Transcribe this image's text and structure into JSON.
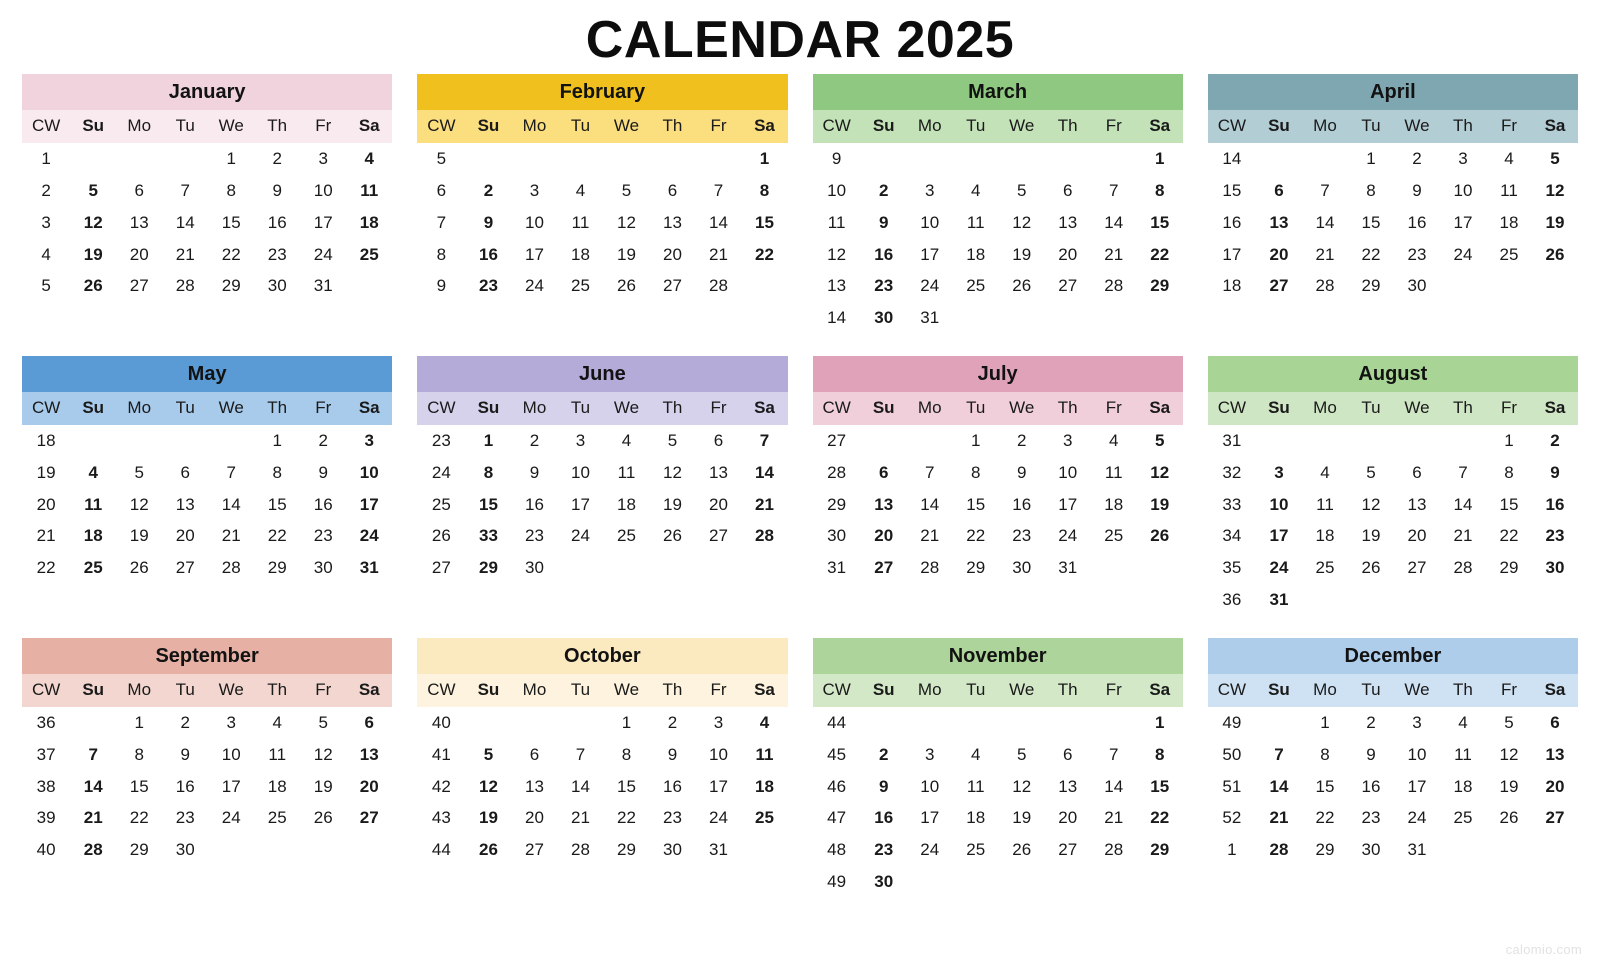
{
  "title": "CALENDAR 2025",
  "watermark": "calomio.com",
  "weekday_headers": [
    "CW",
    "Su",
    "Mo",
    "Tu",
    "We",
    "Th",
    "Fr",
    "Sa"
  ],
  "weekend_columns": [
    1,
    7
  ],
  "colors": {
    "january_header": "#f0d3dc",
    "january_sub": "#f9eaef",
    "february_header": "#f0c01f",
    "february_sub": "#fbde7e",
    "march_header": "#8fc881",
    "march_sub": "#c3e2b8",
    "april_header": "#7fa7b2",
    "april_sub": "#b3cdd4",
    "may_header": "#5b9bd5",
    "may_sub": "#a8cbeb",
    "june_header": "#b4abd8",
    "june_sub": "#d7d2ec",
    "july_header": "#dfa2b8",
    "july_sub": "#f0cfdb",
    "august_header": "#a8d495",
    "august_sub": "#cfe6c4",
    "september_header": "#e6b0a5",
    "september_sub": "#f2d6cf",
    "october_header": "#fbe9bf",
    "october_sub": "#fdf3de",
    "november_header": "#add49a",
    "november_sub": "#d2e8c7",
    "december_header": "#aecdeb",
    "december_sub": "#cfe2f4",
    "title_text": "#0d0d0d",
    "cw_text": "#b3b3b3",
    "day_text": "#111111",
    "watermark_text": "#e2e2e2"
  },
  "months": [
    {
      "name": "January",
      "header_color": "#f0d3dc",
      "sub_color": "#f9eaef",
      "weeks": [
        {
          "cw": "1",
          "days": [
            "",
            "",
            "1",
            "2",
            "3",
            "4"
          ]
        },
        {
          "cw": "2",
          "days": [
            "5",
            "6",
            "7",
            "8",
            "9",
            "10",
            "11"
          ]
        },
        {
          "cw": "3",
          "days": [
            "12",
            "13",
            "14",
            "15",
            "16",
            "17",
            "18"
          ]
        },
        {
          "cw": "4",
          "days": [
            "19",
            "20",
            "21",
            "22",
            "23",
            "24",
            "25"
          ]
        },
        {
          "cw": "5",
          "days": [
            "26",
            "27",
            "28",
            "29",
            "30",
            "31",
            ""
          ]
        }
      ],
      "rows": [
        [
          "1",
          "",
          "",
          "1",
          "2",
          "3",
          "4"
        ],
        [
          "2",
          "5",
          "6",
          "7",
          "8",
          "9",
          "10",
          "11"
        ]
      ]
    },
    {
      "name": "February",
      "header_color": "#f0c01f",
      "sub_color": "#fbde7e",
      "weeks": []
    },
    {
      "name": "March",
      "header_color": "#8fc881",
      "sub_color": "#c3e2b8",
      "weeks": []
    },
    {
      "name": "April",
      "header_color": "#7fa7b2",
      "sub_color": "#b3cdd4",
      "weeks": []
    },
    {
      "name": "May",
      "header_color": "#5b9bd5",
      "sub_color": "#a8cbeb",
      "weeks": []
    },
    {
      "name": "June",
      "header_color": "#b4abd8",
      "sub_color": "#d7d2ec",
      "weeks": []
    },
    {
      "name": "July",
      "header_color": "#dfa2b8",
      "sub_color": "#f0cfdb",
      "weeks": []
    },
    {
      "name": "August",
      "header_color": "#a8d495",
      "sub_color": "#cfe6c4",
      "weeks": []
    },
    {
      "name": "September",
      "header_color": "#e6b0a5",
      "sub_color": "#f2d6cf",
      "weeks": []
    },
    {
      "name": "October",
      "header_color": "#fbe9bf",
      "sub_color": "#fdf3de",
      "weeks": []
    },
    {
      "name": "November",
      "header_color": "#add49a",
      "sub_color": "#d2e8c7",
      "weeks": []
    },
    {
      "name": "December",
      "header_color": "#aecdeb",
      "sub_color": "#cfe2f4",
      "weeks": []
    }
  ],
  "calendar_grid": [
    {
      "name": "January",
      "header_color": "#f0d3dc",
      "sub_color": "#f9eaef",
      "rows": [
        [
          "1",
          "",
          "",
          "",
          "1",
          "2",
          "3",
          "4"
        ],
        [
          "2",
          "5",
          "6",
          "7",
          "8",
          "9",
          "10",
          "11"
        ],
        [
          "3",
          "12",
          "13",
          "14",
          "15",
          "16",
          "17",
          "18"
        ],
        [
          "4",
          "19",
          "20",
          "21",
          "22",
          "23",
          "24",
          "25"
        ],
        [
          "5",
          "26",
          "27",
          "28",
          "29",
          "30",
          "31",
          ""
        ]
      ]
    },
    {
      "name": "February",
      "header_color": "#f0c01f",
      "sub_color": "#fbde7e",
      "rows": [
        [
          "5",
          "",
          "",
          "",
          "",
          "",
          "",
          "1"
        ],
        [
          "6",
          "2",
          "3",
          "4",
          "5",
          "6",
          "7",
          "8"
        ],
        [
          "7",
          "9",
          "10",
          "11",
          "12",
          "13",
          "14",
          "15"
        ],
        [
          "8",
          "16",
          "17",
          "18",
          "19",
          "20",
          "21",
          "22"
        ],
        [
          "9",
          "23",
          "24",
          "25",
          "26",
          "27",
          "28",
          ""
        ]
      ]
    },
    {
      "name": "March",
      "header_color": "#8fc881",
      "sub_color": "#c3e2b8",
      "rows": [
        [
          "9",
          "",
          "",
          "",
          "",
          "",
          "",
          "1"
        ],
        [
          "10",
          "2",
          "3",
          "4",
          "5",
          "6",
          "7",
          "8"
        ],
        [
          "11",
          "9",
          "10",
          "11",
          "12",
          "13",
          "14",
          "15"
        ],
        [
          "12",
          "16",
          "17",
          "18",
          "19",
          "20",
          "21",
          "22"
        ],
        [
          "13",
          "23",
          "24",
          "25",
          "26",
          "27",
          "28",
          "29"
        ],
        [
          "14",
          "30",
          "31",
          "",
          "",
          "",
          "",
          ""
        ]
      ]
    },
    {
      "name": "April",
      "header_color": "#7fa7b2",
      "sub_color": "#b3cdd4",
      "rows": [
        [
          "14",
          "",
          "",
          "1",
          "2",
          "3",
          "4",
          "5"
        ],
        [
          "15",
          "6",
          "7",
          "8",
          "9",
          "10",
          "11",
          "12"
        ],
        [
          "16",
          "13",
          "14",
          "15",
          "16",
          "17",
          "18",
          "19"
        ],
        [
          "17",
          "20",
          "21",
          "22",
          "23",
          "24",
          "25",
          "26"
        ],
        [
          "18",
          "27",
          "28",
          "29",
          "30",
          "",
          "",
          ""
        ]
      ]
    },
    {
      "name": "May",
      "header_color": "#5b9bd5",
      "sub_color": "#a8cbeb",
      "rows": [
        [
          "18",
          "",
          "",
          "",
          "",
          "1",
          "2",
          "3"
        ],
        [
          "19",
          "4",
          "5",
          "6",
          "7",
          "8",
          "9",
          "10"
        ],
        [
          "20",
          "11",
          "12",
          "13",
          "14",
          "15",
          "16",
          "17"
        ],
        [
          "21",
          "18",
          "19",
          "20",
          "21",
          "22",
          "23",
          "24"
        ],
        [
          "22",
          "25",
          "26",
          "27",
          "28",
          "29",
          "30",
          "31"
        ]
      ]
    },
    {
      "name": "June",
      "header_color": "#b4abd8",
      "sub_color": "#d7d2ec",
      "rows": [
        [
          "23",
          "1",
          "2",
          "3",
          "4",
          "5",
          "6",
          "7"
        ],
        [
          "24",
          "8",
          "9",
          "10",
          "11",
          "12",
          "13",
          "14"
        ],
        [
          "25",
          "15",
          "16",
          "17",
          "18",
          "19",
          "20",
          "21"
        ],
        [
          "26",
          "33",
          "23",
          "24",
          "25",
          "26",
          "27",
          "28"
        ],
        [
          "27",
          "29",
          "30",
          "",
          "",
          "",
          "",
          ""
        ]
      ]
    },
    {
      "name": "July",
      "header_color": "#dfa2b8",
      "sub_color": "#f0cfdb",
      "rows": [
        [
          "27",
          "",
          "",
          "1",
          "2",
          "3",
          "4",
          "5"
        ],
        [
          "28",
          "6",
          "7",
          "8",
          "9",
          "10",
          "11",
          "12"
        ],
        [
          "29",
          "13",
          "14",
          "15",
          "16",
          "17",
          "18",
          "19"
        ],
        [
          "30",
          "20",
          "21",
          "22",
          "23",
          "24",
          "25",
          "26"
        ],
        [
          "31",
          "27",
          "28",
          "29",
          "30",
          "31",
          "",
          ""
        ]
      ]
    },
    {
      "name": "August",
      "header_color": "#a8d495",
      "sub_color": "#cfe6c4",
      "rows": [
        [
          "31",
          "",
          "",
          "",
          "",
          "",
          "1",
          "2"
        ],
        [
          "32",
          "3",
          "4",
          "5",
          "6",
          "7",
          "8",
          "9"
        ],
        [
          "33",
          "10",
          "11",
          "12",
          "13",
          "14",
          "15",
          "16"
        ],
        [
          "34",
          "17",
          "18",
          "19",
          "20",
          "21",
          "22",
          "23"
        ],
        [
          "35",
          "24",
          "25",
          "26",
          "27",
          "28",
          "29",
          "30"
        ],
        [
          "36",
          "31",
          "",
          "",
          "",
          "",
          "",
          ""
        ]
      ]
    },
    {
      "name": "September",
      "header_color": "#e6b0a5",
      "sub_color": "#f2d6cf",
      "rows": [
        [
          "36",
          "",
          "1",
          "2",
          "3",
          "4",
          "5",
          "6"
        ],
        [
          "37",
          "7",
          "8",
          "9",
          "10",
          "11",
          "12",
          "13"
        ],
        [
          "38",
          "14",
          "15",
          "16",
          "17",
          "18",
          "19",
          "20"
        ],
        [
          "39",
          "21",
          "22",
          "23",
          "24",
          "25",
          "26",
          "27"
        ],
        [
          "40",
          "28",
          "29",
          "30",
          "",
          "",
          "",
          ""
        ]
      ]
    },
    {
      "name": "October",
      "header_color": "#fbe9bf",
      "sub_color": "#fdf3de",
      "rows": [
        [
          "40",
          "",
          "",
          "",
          "1",
          "2",
          "3",
          "4"
        ],
        [
          "41",
          "5",
          "6",
          "7",
          "8",
          "9",
          "10",
          "11"
        ],
        [
          "42",
          "12",
          "13",
          "14",
          "15",
          "16",
          "17",
          "18"
        ],
        [
          "43",
          "19",
          "20",
          "21",
          "22",
          "23",
          "24",
          "25"
        ],
        [
          "44",
          "26",
          "27",
          "28",
          "29",
          "30",
          "31",
          ""
        ]
      ]
    },
    {
      "name": "November",
      "header_color": "#add49a",
      "sub_color": "#d2e8c7",
      "rows": [
        [
          "44",
          "",
          "",
          "",
          "",
          "",
          "",
          "1"
        ],
        [
          "45",
          "2",
          "3",
          "4",
          "5",
          "6",
          "7",
          "8"
        ],
        [
          "46",
          "9",
          "10",
          "11",
          "12",
          "13",
          "14",
          "15"
        ],
        [
          "47",
          "16",
          "17",
          "18",
          "19",
          "20",
          "21",
          "22"
        ],
        [
          "48",
          "23",
          "24",
          "25",
          "26",
          "27",
          "28",
          "29"
        ],
        [
          "49",
          "30",
          "",
          "",
          "",
          "",
          "",
          ""
        ]
      ]
    },
    {
      "name": "December",
      "header_color": "#aecdeb",
      "sub_color": "#cfe2f4",
      "rows": [
        [
          "49",
          "",
          "1",
          "2",
          "3",
          "4",
          "5",
          "6"
        ],
        [
          "50",
          "7",
          "8",
          "9",
          "10",
          "11",
          "12",
          "13"
        ],
        [
          "51",
          "14",
          "15",
          "16",
          "17",
          "18",
          "19",
          "20"
        ],
        [
          "52",
          "21",
          "22",
          "23",
          "24",
          "25",
          "26",
          "27"
        ],
        [
          "1",
          "28",
          "29",
          "30",
          "31",
          "",
          "",
          ""
        ]
      ]
    }
  ]
}
